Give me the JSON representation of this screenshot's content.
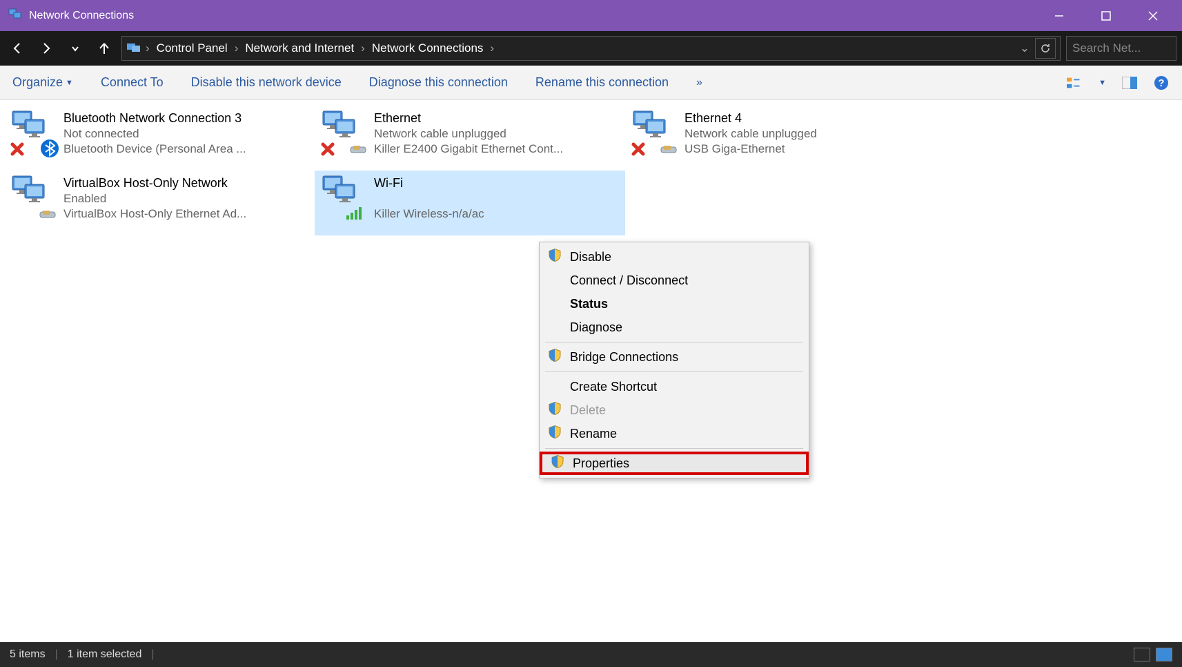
{
  "titlebar": {
    "title": "Network Connections"
  },
  "breadcrumbs": [
    "Control Panel",
    "Network and Internet",
    "Network Connections"
  ],
  "search": {
    "placeholder": "Search Net..."
  },
  "toolbar": {
    "organize": "Organize",
    "connect_to": "Connect To",
    "disable": "Disable this network device",
    "diagnose": "Diagnose this connection",
    "rename": "Rename this connection",
    "overflow": "»"
  },
  "items": [
    {
      "name": "Bluetooth Network Connection 3",
      "status": "Not connected",
      "device": "Bluetooth Device (Personal Area ...",
      "icon": "bt-x"
    },
    {
      "name": "Ethernet",
      "status": "Network cable unplugged",
      "device": "Killer E2400 Gigabit Ethernet Cont...",
      "icon": "eth-x"
    },
    {
      "name": "Ethernet 4",
      "status": "Network cable unplugged",
      "device": "USB  Giga-Ethernet",
      "icon": "eth-x"
    },
    {
      "name": "VirtualBox Host-Only Network",
      "status": "Enabled",
      "device": "VirtualBox Host-Only Ethernet Ad...",
      "icon": "eth"
    },
    {
      "name": "Wi-Fi",
      "status": "",
      "device": "Killer Wireless-n/a/ac",
      "icon": "wifi",
      "selected": true
    }
  ],
  "context_menu": {
    "items": [
      {
        "label": "Disable",
        "shield": true
      },
      {
        "label": "Connect / Disconnect"
      },
      {
        "label": "Status",
        "bold": true
      },
      {
        "label": "Diagnose"
      },
      {
        "sep": true
      },
      {
        "label": "Bridge Connections",
        "shield": true
      },
      {
        "sep": true
      },
      {
        "label": "Create Shortcut"
      },
      {
        "label": "Delete",
        "shield": true,
        "disabled": true
      },
      {
        "label": "Rename",
        "shield": true
      },
      {
        "sep": true
      },
      {
        "label": "Properties",
        "shield": true,
        "highlight": true
      }
    ]
  },
  "statusbar": {
    "count": "5 items",
    "selected": "1 item selected"
  }
}
